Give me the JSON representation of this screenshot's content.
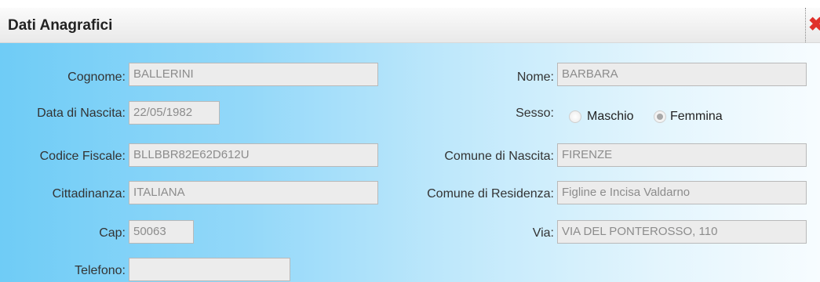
{
  "dialog": {
    "title": "Dati Anagrafici",
    "close_glyph": "✖",
    "close_icon": "close-icon"
  },
  "form": {
    "cognome": {
      "label": "Cognome:",
      "value": "BALLERINI"
    },
    "nome": {
      "label": "Nome:",
      "value": "BARBARA"
    },
    "data_nascita": {
      "label": "Data di Nascita:",
      "value": "22/05/1982"
    },
    "sesso": {
      "label": "Sesso:",
      "options": [
        "Maschio",
        "Femmina"
      ],
      "selected": "Femmina"
    },
    "codice_fiscale": {
      "label": "Codice Fiscale:",
      "value": "BLLBBR82E62D612U"
    },
    "comune_nascita": {
      "label": "Comune di Nascita:",
      "value": "FIRENZE"
    },
    "cittadinanza": {
      "label": "Cittadinanza:",
      "value": "ITALIANA"
    },
    "comune_residenza": {
      "label": "Comune di Residenza:",
      "value": "Figline e Incisa Valdarno"
    },
    "cap": {
      "label": "Cap:",
      "value": "50063"
    },
    "via": {
      "label": "Via:",
      "value": "VIA DEL PONTEROSSO, 110"
    },
    "telefono": {
      "label": "Telefono:",
      "value": ""
    }
  },
  "colors": {
    "accent": "#6fccf6",
    "close": "#e0302a",
    "field_bg": "#ececec"
  }
}
